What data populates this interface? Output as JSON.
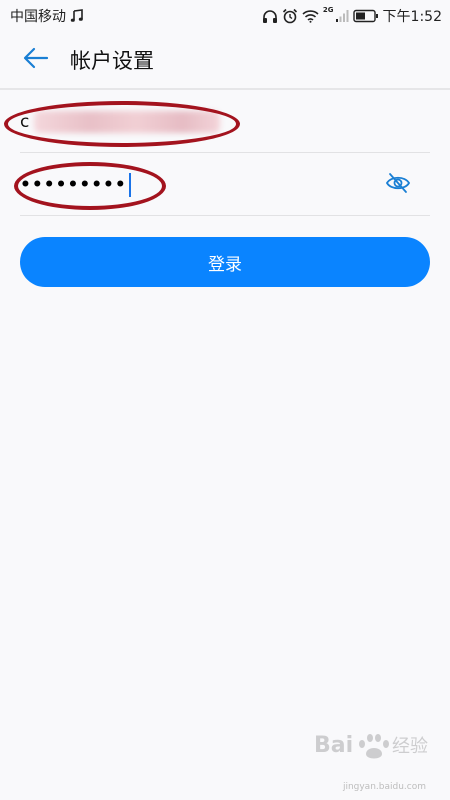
{
  "status_bar": {
    "carrier": "中国移动",
    "network_type": "2G",
    "time": "下午1:52",
    "icons": [
      "music-note-icon",
      "headphones-icon",
      "alarm-icon",
      "wifi-icon",
      "signal-icon",
      "battery-icon"
    ]
  },
  "header": {
    "title": "帐户设置",
    "back_icon": "arrow-left-icon"
  },
  "form": {
    "account_value_visible": "c",
    "password_mask": "•••••••••",
    "eye_icon": "eye-off-icon"
  },
  "login_button": {
    "label": "登录"
  },
  "watermark": {
    "text": "Bai du 经验",
    "url": "jingyan.baidu.com"
  },
  "colors": {
    "accent": "#0a84ff",
    "annotation": "#a3131e",
    "background": "#f9f9fb"
  }
}
